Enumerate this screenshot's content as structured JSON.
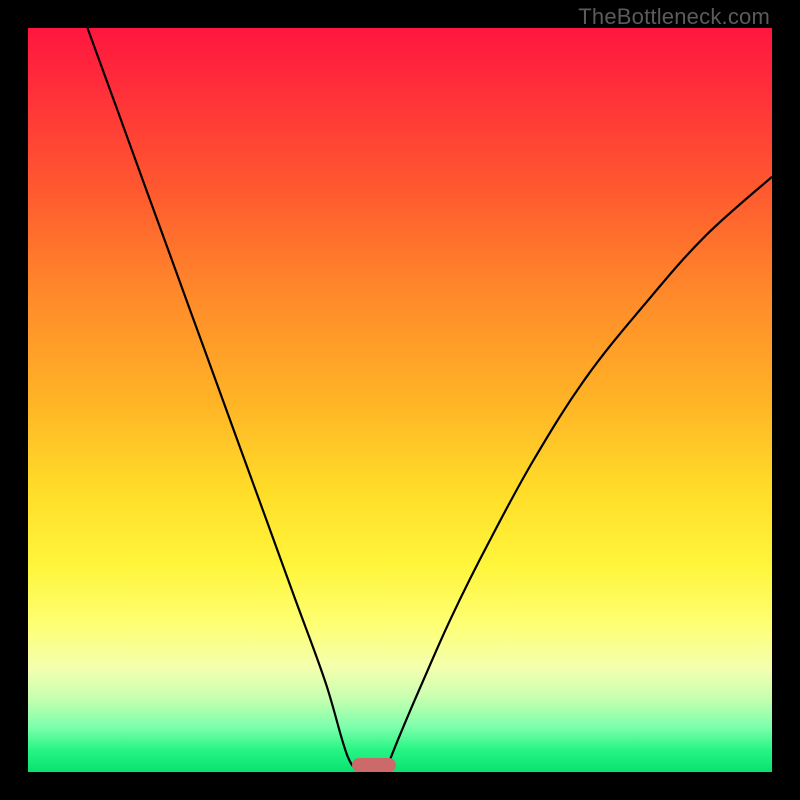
{
  "watermark": "TheBottleneck.com",
  "colors": {
    "frame": "#000000",
    "curve": "#000000",
    "marker": "#cc6a6b",
    "gradient_stops": [
      {
        "pos": 0.0,
        "hex": "#ff163f"
      },
      {
        "pos": 0.08,
        "hex": "#ff2e3a"
      },
      {
        "pos": 0.22,
        "hex": "#ff5a2f"
      },
      {
        "pos": 0.36,
        "hex": "#ff8a2a"
      },
      {
        "pos": 0.5,
        "hex": "#ffb326"
      },
      {
        "pos": 0.62,
        "hex": "#ffdc28"
      },
      {
        "pos": 0.72,
        "hex": "#fff53a"
      },
      {
        "pos": 0.8,
        "hex": "#feff72"
      },
      {
        "pos": 0.86,
        "hex": "#f4ffae"
      },
      {
        "pos": 0.9,
        "hex": "#c8ffb0"
      },
      {
        "pos": 0.94,
        "hex": "#7bffab"
      },
      {
        "pos": 0.97,
        "hex": "#28f584"
      },
      {
        "pos": 1.0,
        "hex": "#08e270"
      }
    ]
  },
  "chart_data": {
    "type": "line",
    "title": "",
    "xlabel": "",
    "ylabel": "",
    "xlim": [
      0,
      100
    ],
    "ylim": [
      0,
      100
    ],
    "series": [
      {
        "name": "left_curve",
        "x": [
          8,
          12,
          16,
          20,
          24,
          28,
          32,
          36,
          40,
          43,
          45
        ],
        "y": [
          100,
          89,
          78,
          67,
          56,
          45,
          34,
          23,
          12,
          2,
          0
        ]
      },
      {
        "name": "right_curve",
        "x": [
          48,
          50,
          53,
          57,
          62,
          68,
          75,
          83,
          91,
          100
        ],
        "y": [
          0,
          5,
          12,
          21,
          31,
          42,
          53,
          63,
          72,
          80
        ]
      }
    ],
    "marker": {
      "x_center": 46.5,
      "y": 0,
      "width_pct": 6
    }
  }
}
